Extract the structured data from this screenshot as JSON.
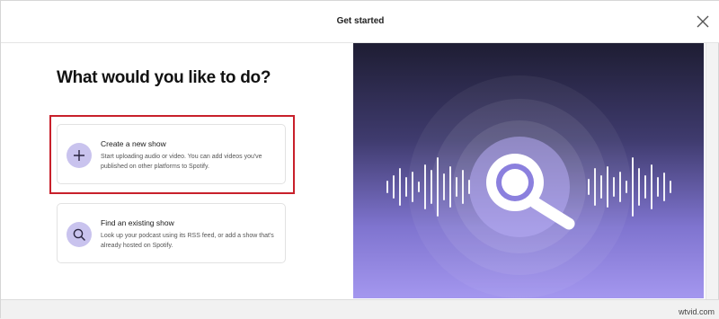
{
  "header": {
    "title": "Get started"
  },
  "main": {
    "heading": "What would you like to do?",
    "options": [
      {
        "title": "Create a new show",
        "description": "Start uploading audio or video. You can add videos you've published on other platforms to Spotify.",
        "icon": "plus-icon",
        "highlighted": true
      },
      {
        "title": "Find an existing show",
        "description": "Look up your podcast using its RSS feed, or add a show that's already hosted on Spotify.",
        "icon": "search-icon",
        "highlighted": false
      }
    ]
  },
  "illustration": {
    "icon": "magnifier-icon"
  },
  "watermark": "wtvid.com",
  "colors": {
    "accent_purple": "#a497ef",
    "icon_bg": "#c9c3ee",
    "highlight_red": "#c8202b",
    "panel_dark": "#1e1d33"
  }
}
